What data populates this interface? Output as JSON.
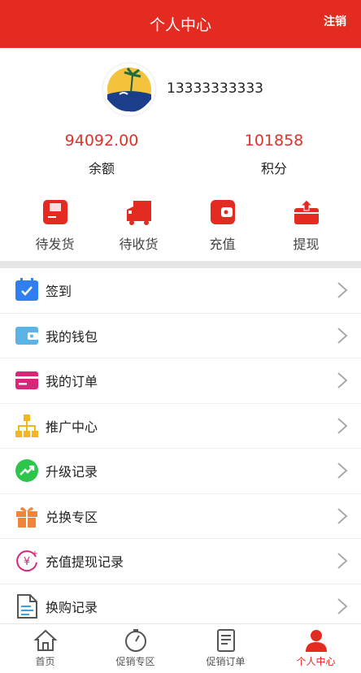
{
  "header": {
    "title": "个人中心",
    "logout_label": "注销"
  },
  "profile": {
    "phone": "13333333333",
    "balance": {
      "value": "94092.00",
      "label": "余额"
    },
    "points": {
      "value": "101858",
      "label": "积分"
    }
  },
  "quick_actions": [
    {
      "label": "待发货",
      "icon": "box-icon"
    },
    {
      "label": "待收货",
      "icon": "truck-icon"
    },
    {
      "label": "充值",
      "icon": "wallet-icon"
    },
    {
      "label": "提现",
      "icon": "withdraw-icon"
    }
  ],
  "menu": [
    {
      "label": "签到",
      "icon": "calendar-check-icon"
    },
    {
      "label": "我的钱包",
      "icon": "wallet-icon"
    },
    {
      "label": "我的订单",
      "icon": "card-icon"
    },
    {
      "label": "推广中心",
      "icon": "network-icon"
    },
    {
      "label": "升级记录",
      "icon": "trend-icon"
    },
    {
      "label": "兑换专区",
      "icon": "gift-icon"
    },
    {
      "label": "充值提现记录",
      "icon": "yen-cycle-icon"
    },
    {
      "label": "换购记录",
      "icon": "document-icon"
    }
  ],
  "tabbar": [
    {
      "label": "首页",
      "icon": "home-icon"
    },
    {
      "label": "促销专区",
      "icon": "timer-icon"
    },
    {
      "label": "促销订单",
      "icon": "order-icon"
    },
    {
      "label": "个人中心",
      "icon": "user-icon",
      "active": true
    }
  ],
  "colors": {
    "brand": "#e32b22",
    "value_red": "#d9332b"
  }
}
